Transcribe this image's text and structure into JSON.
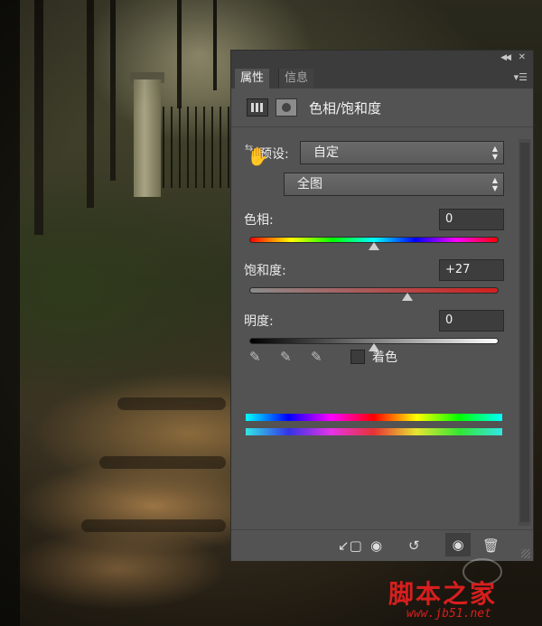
{
  "panel": {
    "tabs": [
      {
        "label": "属性",
        "active": true
      },
      {
        "label": "信息",
        "active": false
      }
    ],
    "title": "色相/饱和度",
    "preset": {
      "label": "预设:",
      "value": "自定"
    },
    "channel": {
      "value": "全图"
    },
    "hue": {
      "label": "色相:",
      "value": "0",
      "level": 0
    },
    "saturation": {
      "label": "饱和度:",
      "value": "+27",
      "level": 27
    },
    "lightness": {
      "label": "明度:",
      "value": "0",
      "level": 0
    },
    "colorize": {
      "label": "着色",
      "checked": false
    }
  },
  "watermark": {
    "text": "脚本之家",
    "url": "www.jb51.net"
  },
  "colors": {
    "panel_bg": "#535353",
    "tab_bar_bg": "#3c3c3c",
    "watermark": "#d81e1e"
  },
  "icons": {
    "adjustment": "hue-saturation-adjustment-icon",
    "mask": "layer-mask-icon",
    "hand": "targeted-adjustment-hand-icon",
    "eyedroppers": [
      "eyedropper-icon",
      "eyedropper-plus-icon",
      "eyedropper-minus-icon"
    ],
    "footer": [
      "clip-to-layer-icon",
      "view-previous-state-icon",
      "reset-icon",
      "toggle-visibility-icon",
      "delete-icon"
    ]
  }
}
